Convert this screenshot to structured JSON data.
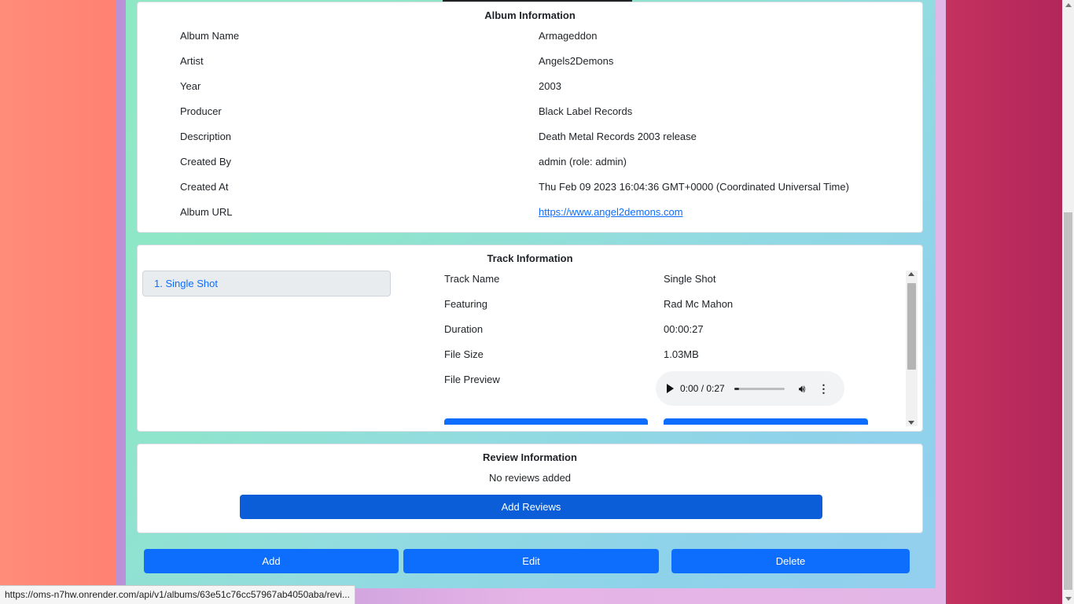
{
  "album": {
    "title": "Album Information",
    "rows": [
      {
        "label": "Album Name",
        "value": "Armageddon"
      },
      {
        "label": "Artist",
        "value": "Angels2Demons"
      },
      {
        "label": "Year",
        "value": "2003"
      },
      {
        "label": "Producer",
        "value": "Black Label Records"
      },
      {
        "label": "Description",
        "value": "Death Metal Records 2003 release"
      },
      {
        "label": "Created By",
        "value": "admin (role: admin)"
      },
      {
        "label": "Created At",
        "value": "Thu Feb 09 2023 16:04:36 GMT+0000 (Coordinated Universal Time)"
      },
      {
        "label": "Album URL",
        "value": "https://www.angel2demons.com"
      }
    ]
  },
  "tracks": {
    "title": "Track Information",
    "list": [
      {
        "label": "1. Single Shot"
      }
    ],
    "rows": [
      {
        "label": "Track Name",
        "value": "Single Shot"
      },
      {
        "label": "Featuring",
        "value": "Rad Mc Mahon"
      },
      {
        "label": "Duration",
        "value": "00:00:27"
      },
      {
        "label": "File Size",
        "value": "1.03MB"
      },
      {
        "label": "File Preview",
        "value": ""
      }
    ],
    "player": {
      "time": "0:00 / 0:27",
      "progress_fraction": 0.1
    }
  },
  "reviews": {
    "title": "Review Information",
    "empty_text": "No reviews added",
    "add_label": "Add Reviews"
  },
  "actions": {
    "add_label": "Add",
    "edit_label": "Edit",
    "delete_label": "Delete"
  },
  "status_bar": {
    "url": "https://oms-n7hw.onrender.com/api/v1/albums/63e51c76cc57967ab4050aba/revi..."
  },
  "colors": {
    "primary": "#0d6efd",
    "dark_primary": "#0b5ed7"
  }
}
